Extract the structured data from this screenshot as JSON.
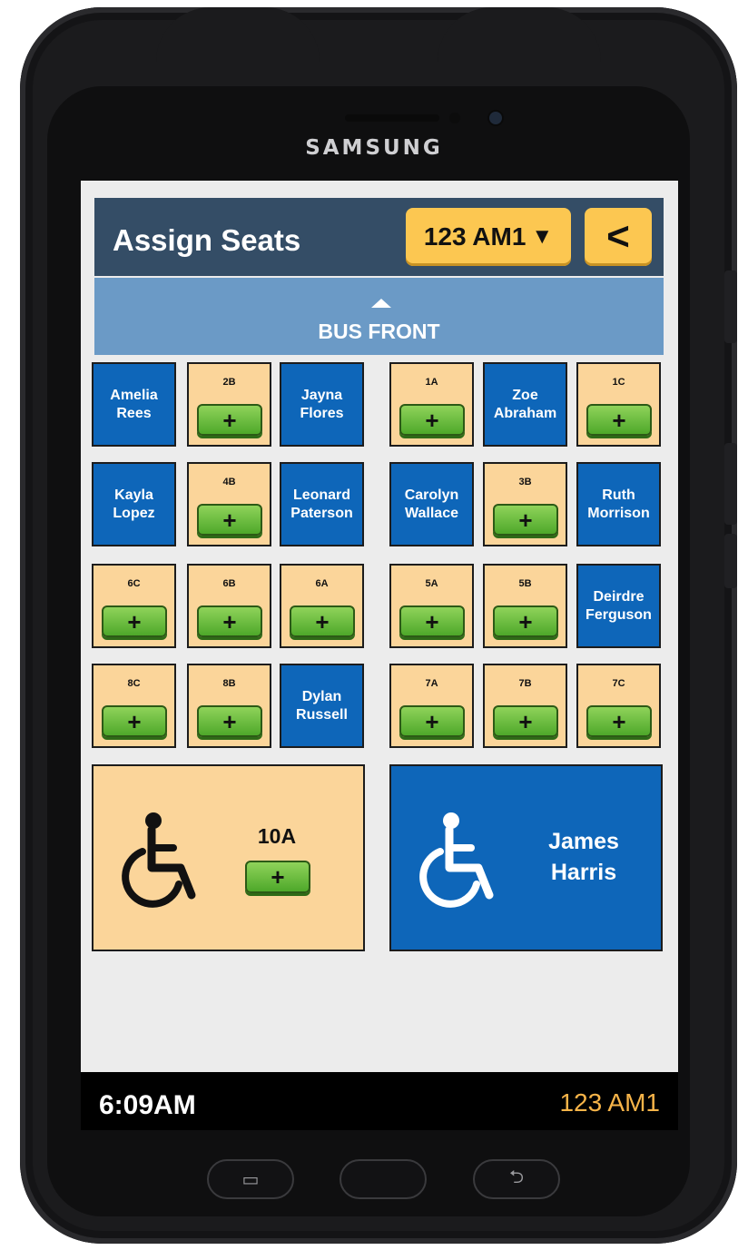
{
  "device": {
    "brand": "SAMSUNG"
  },
  "header": {
    "title": "Assign Seats",
    "route_selector": "123 AM1",
    "route_selector_arrow": "▼",
    "back_label": "<"
  },
  "bus_front": {
    "label": "BUS FRONT"
  },
  "seats": [
    {
      "row": 0,
      "col": 0,
      "status": "taken",
      "name": "Amelia Rees"
    },
    {
      "row": 0,
      "col": 1,
      "status": "empty",
      "code": "2B"
    },
    {
      "row": 0,
      "col": 2,
      "status": "taken",
      "name": "Jayna Flores"
    },
    {
      "row": 0,
      "col": 3,
      "status": "empty",
      "code": "1A"
    },
    {
      "row": 0,
      "col": 4,
      "status": "taken",
      "name": "Zoe Abraham"
    },
    {
      "row": 0,
      "col": 5,
      "status": "empty",
      "code": "1C"
    },
    {
      "row": 1,
      "col": 0,
      "status": "taken",
      "name": "Kayla Lopez"
    },
    {
      "row": 1,
      "col": 1,
      "status": "empty",
      "code": "4B"
    },
    {
      "row": 1,
      "col": 2,
      "status": "taken",
      "name": "Leonard Paterson"
    },
    {
      "row": 1,
      "col": 3,
      "status": "taken",
      "name": "Carolyn Wallace"
    },
    {
      "row": 1,
      "col": 4,
      "status": "empty",
      "code": "3B"
    },
    {
      "row": 1,
      "col": 5,
      "status": "taken",
      "name": "Ruth Morrison"
    },
    {
      "row": 2,
      "col": 0,
      "status": "empty",
      "code": "6C"
    },
    {
      "row": 2,
      "col": 1,
      "status": "empty",
      "code": "6B"
    },
    {
      "row": 2,
      "col": 2,
      "status": "empty",
      "code": "6A"
    },
    {
      "row": 2,
      "col": 3,
      "status": "empty",
      "code": "5A"
    },
    {
      "row": 2,
      "col": 4,
      "status": "empty",
      "code": "5B"
    },
    {
      "row": 2,
      "col": 5,
      "status": "taken",
      "name": "Deirdre Ferguson"
    },
    {
      "row": 3,
      "col": 0,
      "status": "empty",
      "code": "8C"
    },
    {
      "row": 3,
      "col": 1,
      "status": "empty",
      "code": "8B"
    },
    {
      "row": 3,
      "col": 2,
      "status": "taken",
      "name": "Dylan Russell"
    },
    {
      "row": 3,
      "col": 3,
      "status": "empty",
      "code": "7A"
    },
    {
      "row": 3,
      "col": 4,
      "status": "empty",
      "code": "7B"
    },
    {
      "row": 3,
      "col": 5,
      "status": "empty",
      "code": "7C"
    }
  ],
  "plus_label": "+",
  "wheelchair_seats": [
    {
      "status": "empty",
      "code": "10A",
      "icon": "wheelchair-icon"
    },
    {
      "status": "taken",
      "name_line1": "James",
      "name_line2": "Harris",
      "icon": "wheelchair-icon"
    }
  ],
  "status_bar": {
    "time": "6:09AM",
    "route": "123 AM1"
  },
  "nav_keys": {
    "recent": "▭",
    "back": "⮌"
  },
  "colors": {
    "header": "#344d66",
    "bus_front": "#6b9ac6",
    "taken_seat": "#0e66b9",
    "empty_seat": "#fbd59a",
    "yellow_button": "#fcc751",
    "add_button": "#5bb534",
    "status_route": "#f7b449"
  }
}
